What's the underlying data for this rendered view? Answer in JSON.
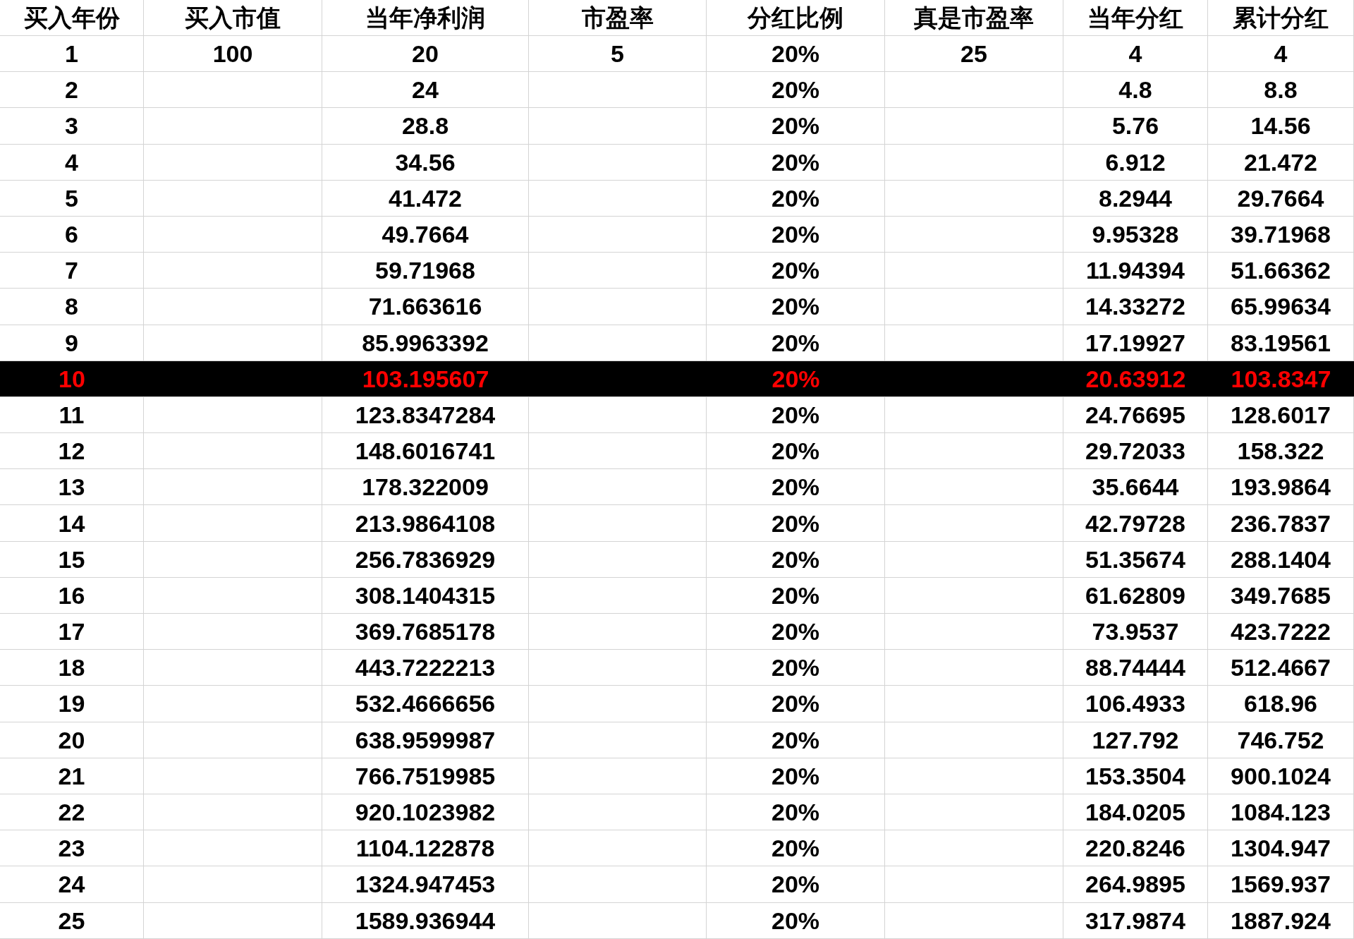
{
  "table": {
    "columns": [
      "买入年份",
      "买入市值",
      "当年净利润",
      "市盈率",
      "分红比例",
      "真是市盈率",
      "当年分红",
      "累计分红"
    ],
    "rows": [
      {
        "highlighted": false,
        "cells": [
          "1",
          "100",
          "20",
          "5",
          "20%",
          "25",
          "4",
          "4"
        ]
      },
      {
        "highlighted": false,
        "cells": [
          "2",
          null,
          "24",
          null,
          "20%",
          null,
          "4.8",
          "8.8"
        ]
      },
      {
        "highlighted": false,
        "cells": [
          "3",
          null,
          "28.8",
          null,
          "20%",
          null,
          "5.76",
          "14.56"
        ]
      },
      {
        "highlighted": false,
        "cells": [
          "4",
          null,
          "34.56",
          null,
          "20%",
          null,
          "6.912",
          "21.472"
        ]
      },
      {
        "highlighted": false,
        "cells": [
          "5",
          null,
          "41.472",
          null,
          "20%",
          null,
          "8.2944",
          "29.7664"
        ]
      },
      {
        "highlighted": false,
        "cells": [
          "6",
          null,
          "49.7664",
          null,
          "20%",
          null,
          "9.95328",
          "39.71968"
        ]
      },
      {
        "highlighted": false,
        "cells": [
          "7",
          null,
          "59.71968",
          null,
          "20%",
          null,
          "11.94394",
          "51.66362"
        ]
      },
      {
        "highlighted": false,
        "cells": [
          "8",
          null,
          "71.663616",
          null,
          "20%",
          null,
          "14.33272",
          "65.99634"
        ]
      },
      {
        "highlighted": false,
        "cells": [
          "9",
          null,
          "85.9963392",
          null,
          "20%",
          null,
          "17.19927",
          "83.19561"
        ]
      },
      {
        "highlighted": true,
        "cells": [
          "10",
          null,
          "103.195607",
          null,
          "20%",
          null,
          "20.63912",
          "103.8347"
        ]
      },
      {
        "highlighted": false,
        "cells": [
          "11",
          null,
          "123.8347284",
          null,
          "20%",
          null,
          "24.76695",
          "128.6017"
        ]
      },
      {
        "highlighted": false,
        "cells": [
          "12",
          null,
          "148.6016741",
          null,
          "20%",
          null,
          "29.72033",
          "158.322"
        ]
      },
      {
        "highlighted": false,
        "cells": [
          "13",
          null,
          "178.322009",
          null,
          "20%",
          null,
          "35.6644",
          "193.9864"
        ]
      },
      {
        "highlighted": false,
        "cells": [
          "14",
          null,
          "213.9864108",
          null,
          "20%",
          null,
          "42.79728",
          "236.7837"
        ]
      },
      {
        "highlighted": false,
        "cells": [
          "15",
          null,
          "256.7836929",
          null,
          "20%",
          null,
          "51.35674",
          "288.1404"
        ]
      },
      {
        "highlighted": false,
        "cells": [
          "16",
          null,
          "308.1404315",
          null,
          "20%",
          null,
          "61.62809",
          "349.7685"
        ]
      },
      {
        "highlighted": false,
        "cells": [
          "17",
          null,
          "369.7685178",
          null,
          "20%",
          null,
          "73.9537",
          "423.7222"
        ]
      },
      {
        "highlighted": false,
        "cells": [
          "18",
          null,
          "443.7222213",
          null,
          "20%",
          null,
          "88.74444",
          "512.4667"
        ]
      },
      {
        "highlighted": false,
        "cells": [
          "19",
          null,
          "532.4666656",
          null,
          "20%",
          null,
          "106.4933",
          "618.96"
        ]
      },
      {
        "highlighted": false,
        "cells": [
          "20",
          null,
          "638.9599987",
          null,
          "20%",
          null,
          "127.792",
          "746.752"
        ]
      },
      {
        "highlighted": false,
        "cells": [
          "21",
          null,
          "766.7519985",
          null,
          "20%",
          null,
          "153.3504",
          "900.1024"
        ]
      },
      {
        "highlighted": false,
        "cells": [
          "22",
          null,
          "920.1023982",
          null,
          "20%",
          null,
          "184.0205",
          "1084.123"
        ]
      },
      {
        "highlighted": false,
        "cells": [
          "23",
          null,
          "1104.122878",
          null,
          "20%",
          null,
          "220.8246",
          "1304.947"
        ]
      },
      {
        "highlighted": false,
        "cells": [
          "24",
          null,
          "1324.947453",
          null,
          "20%",
          null,
          "264.9895",
          "1569.937"
        ]
      },
      {
        "highlighted": false,
        "cells": [
          "25",
          null,
          "1589.936944",
          null,
          "20%",
          null,
          "317.9874",
          "1887.924"
        ]
      }
    ]
  }
}
